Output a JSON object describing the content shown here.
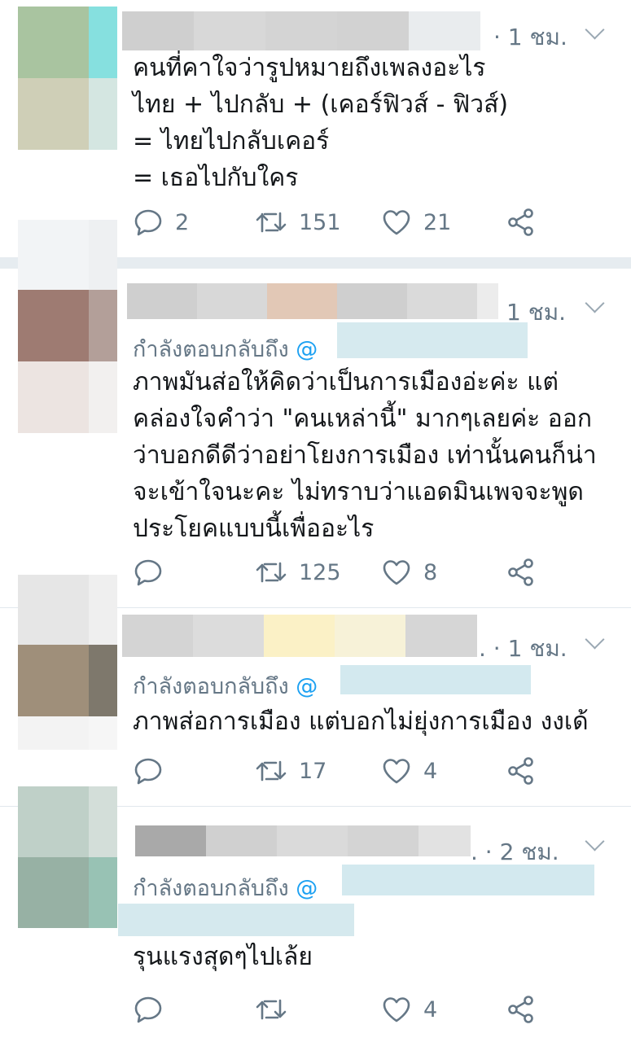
{
  "tweets": [
    {
      "time": "· 1 ชม.",
      "reply_to": "",
      "body": "คนที่คาใจว่ารูปหมายถึงเพลงอะไร\nไทย + ไปกลับ + (เคอร์ฟิวส์ - ฟิวส์)\n= ไทยไปกลับเคอร์\n= เธอไปกับใคร",
      "replies": "2",
      "retweets": "151",
      "likes": "21"
    },
    {
      "time": "1 ชม.",
      "reply_to": "กำลังตอบกลับถึง",
      "reply_at": "@",
      "body": "ภาพมันส่อให้คิดว่าเป็นการเมืองอ่ะค่ะ แต่\nคล่องใจคำว่า \"คนเหล่านี้\" มากๆเลยค่ะ ออก\nว่าบอกดีดีว่าอย่าโยงการเมือง เท่านั้นคนก็น่า\nจะเข้าใจนะคะ ไม่ทราบว่าแอดมินเพจจะพูด\nประโยคแบบนี้เพื่ออะไร",
      "replies": "",
      "retweets": "125",
      "likes": "8"
    },
    {
      "time": ". · 1 ชม.",
      "reply_to": "กำลังตอบกลับถึง",
      "reply_at": "@",
      "body": "ภาพส่อการเมือง แต่บอกไม่ยุ่งการเมือง งงเด้",
      "replies": "",
      "retweets": "17",
      "likes": "4"
    },
    {
      "time": ". · 2 ชม.",
      "reply_to": "กำลังตอบกลับถึง",
      "reply_at": "@",
      "body": "รุนแรงสุดๆไปเล้ย",
      "replies": "",
      "retweets": "",
      "likes": "4"
    }
  ],
  "icons": {
    "reply": "speech-bubble",
    "retweet": "retweet-arrows",
    "like": "heart-outline",
    "share": "share-nodes",
    "menu": "chevron-down"
  },
  "colors": {
    "text": "#14171a",
    "secondary": "#657786",
    "accent": "#1da1f2",
    "divider": "#e1e8ed"
  }
}
